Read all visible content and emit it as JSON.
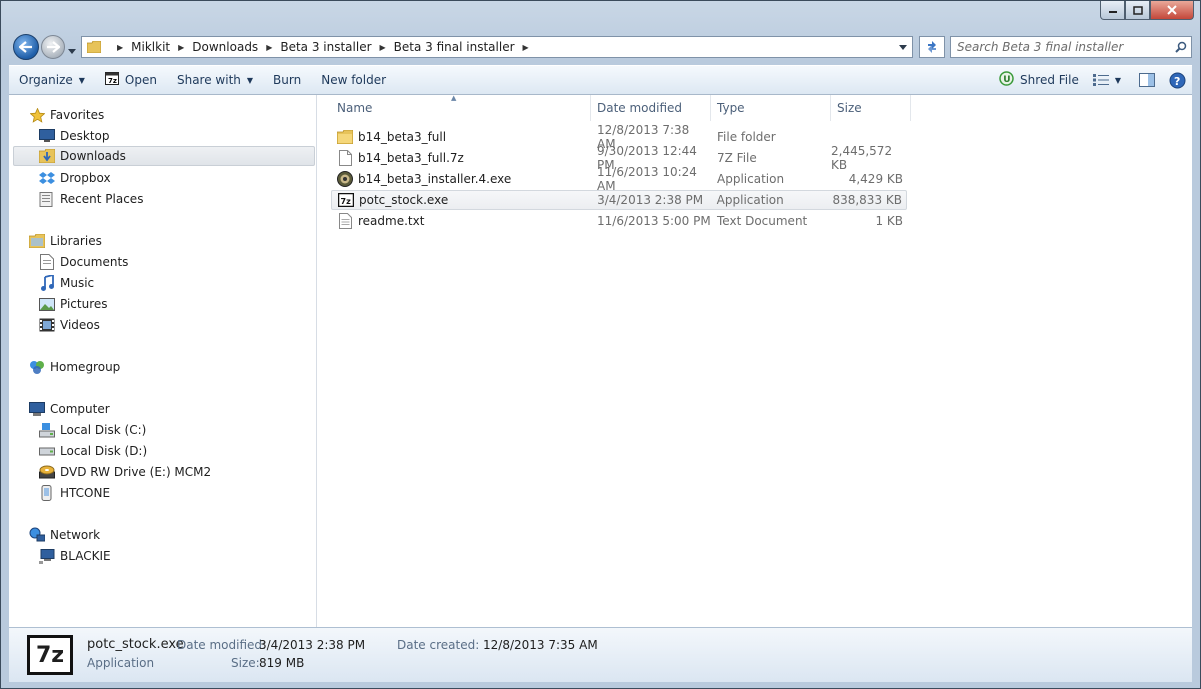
{
  "window": {
    "title_buttons": [
      "minimize",
      "maximize",
      "close"
    ]
  },
  "address": {
    "crumbs": [
      "Miklkit",
      "Downloads",
      "Beta 3 installer",
      "Beta 3 final installer"
    ]
  },
  "search": {
    "placeholder": "Search Beta 3 final installer"
  },
  "toolbar": {
    "organize": "Organize",
    "open": "Open",
    "share_with": "Share with",
    "burn": "Burn",
    "new_folder": "New folder",
    "shred_file": "Shred File"
  },
  "sidebar": {
    "favorites": "Favorites",
    "fav_items": [
      "Desktop",
      "Downloads",
      "Dropbox",
      "Recent Places"
    ],
    "libraries": "Libraries",
    "lib_items": [
      "Documents",
      "Music",
      "Pictures",
      "Videos"
    ],
    "homegroup": "Homegroup",
    "computer": "Computer",
    "comp_items": [
      "Local Disk (C:)",
      "Local Disk (D:)",
      "DVD RW Drive (E:) MCM2",
      "HTCONE"
    ],
    "network": "Network",
    "net_items": [
      "BLACKIE"
    ],
    "selected": "Downloads"
  },
  "columns": {
    "name": "Name",
    "date": "Date modified",
    "type": "Type",
    "size": "Size"
  },
  "files": [
    {
      "name": "b14_beta3_full",
      "date": "12/8/2013 7:38 AM",
      "type": "File folder",
      "size": "",
      "icon": "folder-icon"
    },
    {
      "name": "b14_beta3_full.7z",
      "date": "9/30/2013 12:44 PM",
      "type": "7Z File",
      "size": "2,445,572 KB",
      "icon": "file-icon"
    },
    {
      "name": "b14_beta3_installer.4.exe",
      "date": "11/6/2013 10:24 AM",
      "type": "Application",
      "size": "4,429 KB",
      "icon": "installer-icon"
    },
    {
      "name": "potc_stock.exe",
      "date": "3/4/2013 2:38 PM",
      "type": "Application",
      "size": "838,833 KB",
      "icon": "7z-icon"
    },
    {
      "name": "readme.txt",
      "date": "11/6/2013 5:00 PM",
      "type": "Text Document",
      "size": "1 KB",
      "icon": "text-file-icon"
    }
  ],
  "details": {
    "icon_text": "7z",
    "name": "potc_stock.exe",
    "type": "Application",
    "modified_label": "Date modified:",
    "modified": "3/4/2013 2:38 PM",
    "size_label": "Size:",
    "size": "819 MB",
    "created_label": "Date created:",
    "created": "12/8/2013 7:35 AM"
  }
}
